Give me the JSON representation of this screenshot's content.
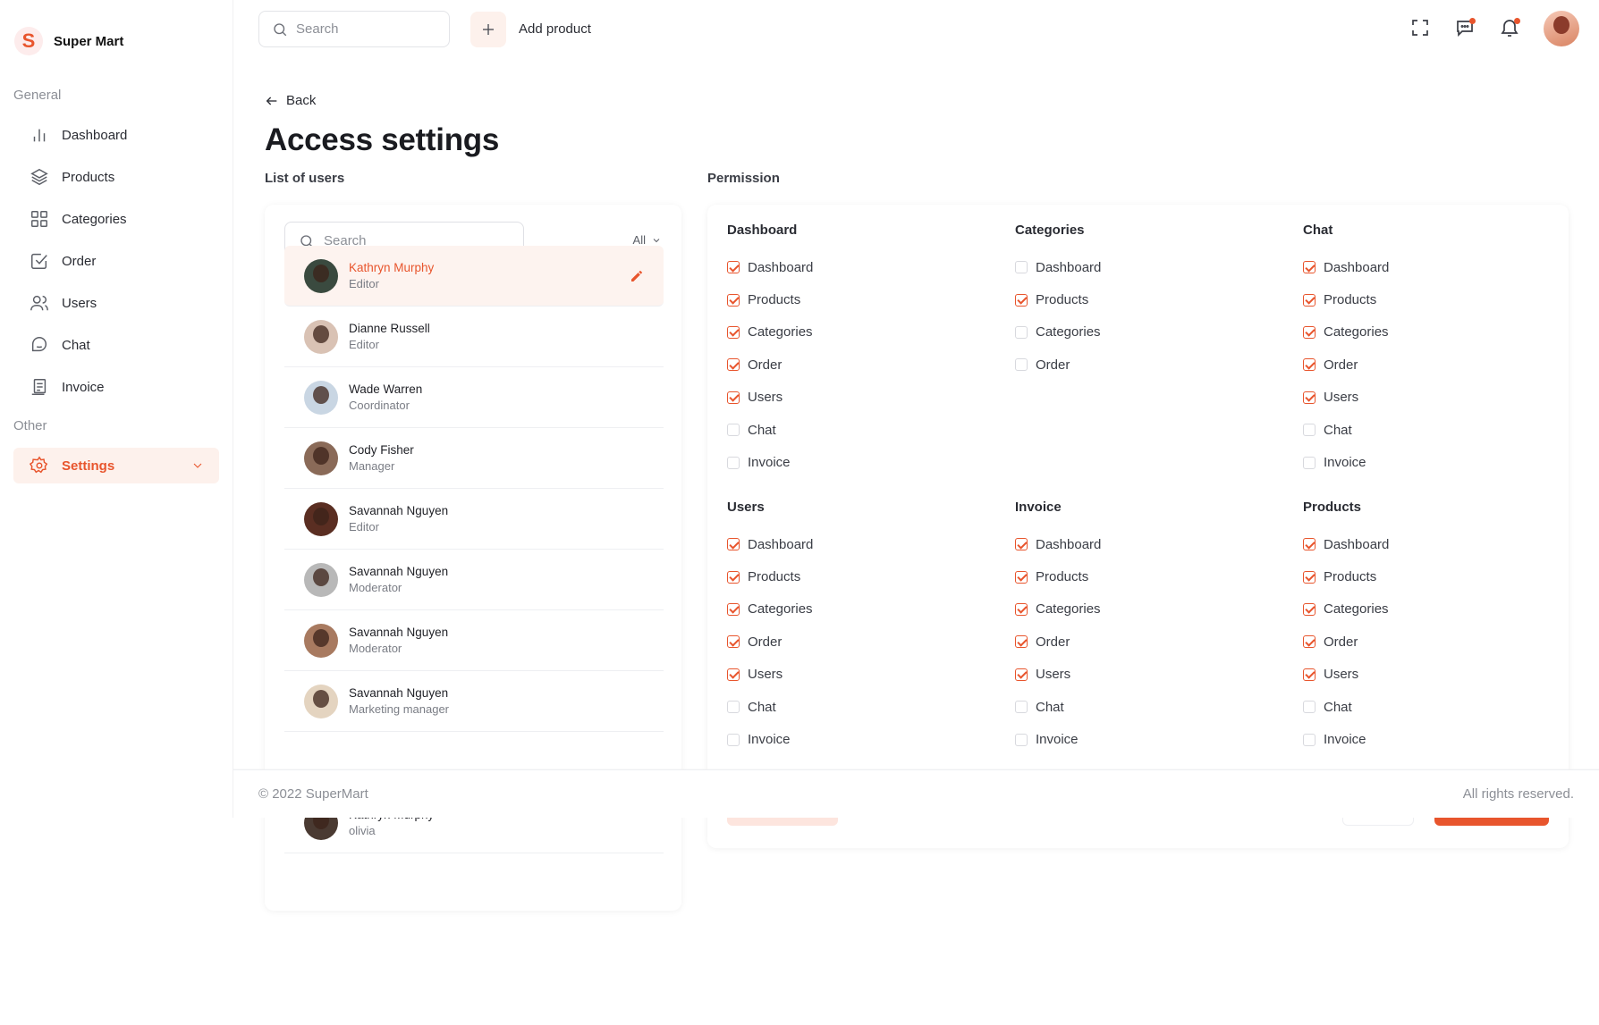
{
  "brand": {
    "logo_letter": "S",
    "name": "Super Mart"
  },
  "sidebar": {
    "sections": {
      "general": "General",
      "other": "Other"
    },
    "items": [
      {
        "label": "Dashboard",
        "icon": "bar-chart-icon"
      },
      {
        "label": "Products",
        "icon": "layers-icon"
      },
      {
        "label": "Categories",
        "icon": "grid-icon"
      },
      {
        "label": "Order",
        "icon": "check-square-icon"
      },
      {
        "label": "Users",
        "icon": "users-icon"
      },
      {
        "label": "Chat",
        "icon": "chat-icon"
      },
      {
        "label": "Invoice",
        "icon": "invoice-icon"
      }
    ],
    "settings": {
      "label": "Settings",
      "icon": "gear-icon",
      "active": true
    }
  },
  "header": {
    "search_placeholder": "Search",
    "add_product_label": "Add product",
    "icons": [
      "fullscreen-icon",
      "chat-bubble-icon",
      "bell-icon",
      "avatar"
    ]
  },
  "page": {
    "back_label": "Back",
    "title": "Access settings",
    "users_heading": "List of users",
    "permission_heading": "Permission"
  },
  "users_panel": {
    "search_placeholder": "Search",
    "filter_label": "All",
    "users": [
      {
        "name": "Kathryn Murphy",
        "role": "Editor",
        "selected": true,
        "avatar_color": "#3a4a3f"
      },
      {
        "name": "Dianne Russell",
        "role": "Editor",
        "selected": false,
        "avatar_color": "#d9c2b4"
      },
      {
        "name": "Wade Warren",
        "role": "Coordinator",
        "selected": false,
        "avatar_color": "#c9d6e3"
      },
      {
        "name": "Cody Fisher",
        "role": "Manager",
        "selected": false,
        "avatar_color": "#8a6a58"
      },
      {
        "name": "Savannah Nguyen",
        "role": "Editor",
        "selected": false,
        "avatar_color": "#5a2e22"
      },
      {
        "name": "Savannah Nguyen",
        "role": "Moderator",
        "selected": false,
        "avatar_color": "#b8b8b8"
      },
      {
        "name": "Savannah Nguyen",
        "role": "Moderator",
        "selected": false,
        "avatar_color": "#a87a60"
      },
      {
        "name": "Savannah Nguyen",
        "role": "Marketing manager",
        "selected": false,
        "avatar_color": "#e4d4c0"
      },
      {
        "name": "",
        "role": "",
        "selected": false,
        "avatar_color": "#ffffff"
      },
      {
        "name": "Kathryn Murphy",
        "role": "olivia",
        "selected": false,
        "avatar_color": "#4a3a32"
      }
    ]
  },
  "permissions": [
    {
      "title": "Dashboard",
      "items": [
        {
          "label": "Dashboard",
          "checked": true
        },
        {
          "label": "Products",
          "checked": true
        },
        {
          "label": "Categories",
          "checked": true
        },
        {
          "label": "Order",
          "checked": true
        },
        {
          "label": "Users",
          "checked": true
        },
        {
          "label": "Chat",
          "checked": false
        },
        {
          "label": "Invoice",
          "checked": false
        }
      ]
    },
    {
      "title": "Categories",
      "items": [
        {
          "label": "Dashboard",
          "checked": false
        },
        {
          "label": "Products",
          "checked": true
        },
        {
          "label": "Categories",
          "checked": false
        },
        {
          "label": "Order",
          "checked": false
        }
      ]
    },
    {
      "title": "Chat",
      "items": [
        {
          "label": "Dashboard",
          "checked": true
        },
        {
          "label": "Products",
          "checked": true
        },
        {
          "label": "Categories",
          "checked": true
        },
        {
          "label": "Order",
          "checked": true
        },
        {
          "label": "Users",
          "checked": true
        },
        {
          "label": "Chat",
          "checked": false
        },
        {
          "label": "Invoice",
          "checked": false
        }
      ]
    },
    {
      "title": "Users",
      "items": [
        {
          "label": "Dashboard",
          "checked": true
        },
        {
          "label": "Products",
          "checked": true
        },
        {
          "label": "Categories",
          "checked": true
        },
        {
          "label": "Order",
          "checked": true
        },
        {
          "label": "Users",
          "checked": true
        },
        {
          "label": "Chat",
          "checked": false
        },
        {
          "label": "Invoice",
          "checked": false
        }
      ]
    },
    {
      "title": "Invoice",
      "items": [
        {
          "label": "Dashboard",
          "checked": true
        },
        {
          "label": "Products",
          "checked": true
        },
        {
          "label": "Categories",
          "checked": true
        },
        {
          "label": "Order",
          "checked": true
        },
        {
          "label": "Users",
          "checked": true
        },
        {
          "label": "Chat",
          "checked": false
        },
        {
          "label": "Invoice",
          "checked": false
        }
      ]
    },
    {
      "title": "Products",
      "items": [
        {
          "label": "Dashboard",
          "checked": true
        },
        {
          "label": "Products",
          "checked": true
        },
        {
          "label": "Categories",
          "checked": true
        },
        {
          "label": "Order",
          "checked": true
        },
        {
          "label": "Users",
          "checked": true
        },
        {
          "label": "Chat",
          "checked": false
        },
        {
          "label": "Invoice",
          "checked": false
        }
      ]
    }
  ],
  "footer": {
    "copyright": "© 2022 SuperMart",
    "rights": "All rights reserved."
  },
  "colors": {
    "accent": "#e8552d",
    "accent_light": "#fdf1ec"
  }
}
